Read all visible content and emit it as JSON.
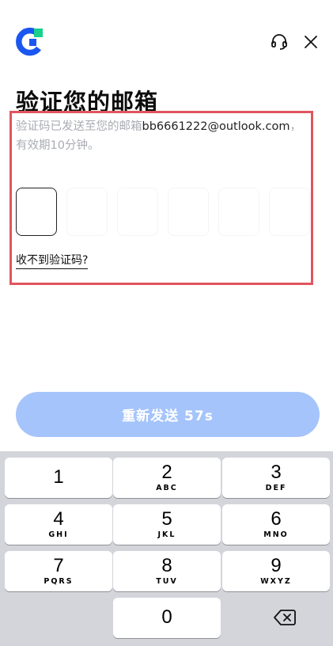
{
  "header": {
    "logo_icon": "brand-logo-icon",
    "support_icon": "headset-icon",
    "close_icon": "close-icon"
  },
  "title": "验证您的邮箱",
  "description": {
    "prefix": "验证码已发送至您的邮箱",
    "email": "bb6661222@outlook.com",
    "suffix": "，有效期10分钟。"
  },
  "code_input": {
    "length": 6,
    "filled": 0
  },
  "resend_link": "收不到验证码?",
  "resend_button": "重新发送 57s",
  "keypad": [
    {
      "num": "1",
      "letters": ""
    },
    {
      "num": "2",
      "letters": "ABC"
    },
    {
      "num": "3",
      "letters": "DEF"
    },
    {
      "num": "4",
      "letters": "GHI"
    },
    {
      "num": "5",
      "letters": "JKL"
    },
    {
      "num": "6",
      "letters": "MNO"
    },
    {
      "num": "7",
      "letters": "PQRS"
    },
    {
      "num": "8",
      "letters": "TUV"
    },
    {
      "num": "9",
      "letters": "WXYZ"
    },
    {
      "num": "0",
      "letters": ""
    }
  ],
  "backspace_icon": "backspace-icon",
  "colors": {
    "brand_blue": "#1a56f0",
    "brand_green": "#18d18c",
    "button_disabled": "#a5c4fb",
    "highlight": "#e0555f"
  }
}
